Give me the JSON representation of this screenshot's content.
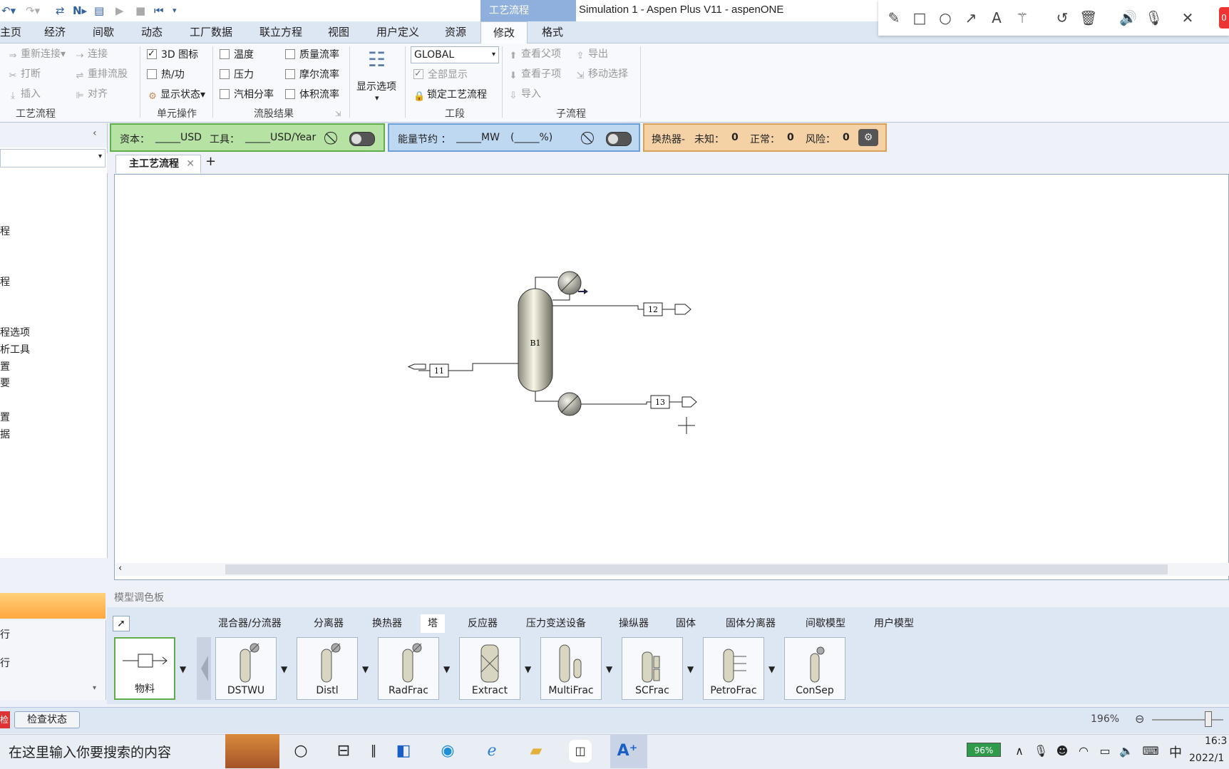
{
  "window": {
    "title": "Simulation 1 - Aspen Plus V11 - aspenONE",
    "context_tab": "工艺流程"
  },
  "ribbon_tabs": [
    "主页",
    "经济",
    "间歇",
    "动态",
    "工厂数据",
    "联立方程",
    "视图",
    "用户定义",
    "资源",
    "修改",
    "格式"
  ],
  "ribbon": {
    "flowsheet": {
      "reconnect": "重新连接",
      "connect": "连接",
      "break": "打断",
      "reroute": "重排流股",
      "insert": "插入",
      "align": "对齐",
      "label": "工艺流程"
    },
    "unit_ops": {
      "icon_3d": "3D 图标",
      "heat_work": "热/功",
      "show_status": "显示状态",
      "label": "单元操作"
    },
    "stream_results": {
      "temperature": "温度",
      "pressure": "压力",
      "vapor_fraction": "汽相分率",
      "mass_flow": "质量流率",
      "mole_flow": "摩尔流率",
      "volume_flow": "体积流率",
      "label": "流股结果"
    },
    "display_options": "显示选项",
    "section": {
      "combo_value": "GLOBAL",
      "show_all": "全部显示",
      "lock_flowsheet": "锁定工艺流程",
      "label": "工段"
    },
    "hierarchy": {
      "view_parent": "查看父项",
      "view_child": "查看子项",
      "import": "导入",
      "export": "导出",
      "move_selection": "移动选择",
      "label": "子流程"
    }
  },
  "status_bars": {
    "capital": "资本：",
    "capital_unit": "_____USD",
    "utility": "工具：",
    "utility_unit": "_____USD/Year",
    "energy": "能量节约 ：",
    "energy_unit": "_____MW",
    "energy_pct": "(_____%)",
    "hx": "换热器-",
    "unknown_label": "未知：",
    "unknown_value": "0",
    "ok_label": "正常：",
    "ok_value": "0",
    "risk_label": "风险：",
    "risk_value": "0"
  },
  "left_nav": {
    "items": [
      "程",
      "程",
      "程选项",
      "析工具",
      "置",
      "要",
      "置",
      "据"
    ],
    "lower_items": [
      "行",
      "行"
    ]
  },
  "document_tab": "主工艺流程",
  "flowsheet": {
    "block": "B1",
    "feed_stream": "11",
    "top_stream": "12",
    "bottom_stream": "13"
  },
  "palette": {
    "title": "模型调色板",
    "tabs": [
      "混合器/分流器",
      "分离器",
      "换热器",
      "塔",
      "反应器",
      "压力变送设备",
      "操纵器",
      "固体",
      "固体分离器",
      "间歇模型",
      "用户模型"
    ],
    "active_tab": "塔",
    "material": "物料",
    "models": [
      "DSTWU",
      "Distl",
      "RadFrac",
      "Extract",
      "MultiFrac",
      "SCFrac",
      "PetroFrac",
      "ConSep"
    ]
  },
  "statusbar": {
    "check_status": "检查状态",
    "zoom": "196%"
  },
  "taskbar": {
    "search": "在这里输入你要搜索的内容",
    "battery": "96%",
    "ime": "中",
    "time": "16:3",
    "date": "2022/1"
  },
  "colors": {
    "green_bar": "#b6e2a4",
    "blue_bar": "#bfd8f2",
    "orange_bar": "#f4d2a6",
    "ribbon": "#dde6f3"
  }
}
